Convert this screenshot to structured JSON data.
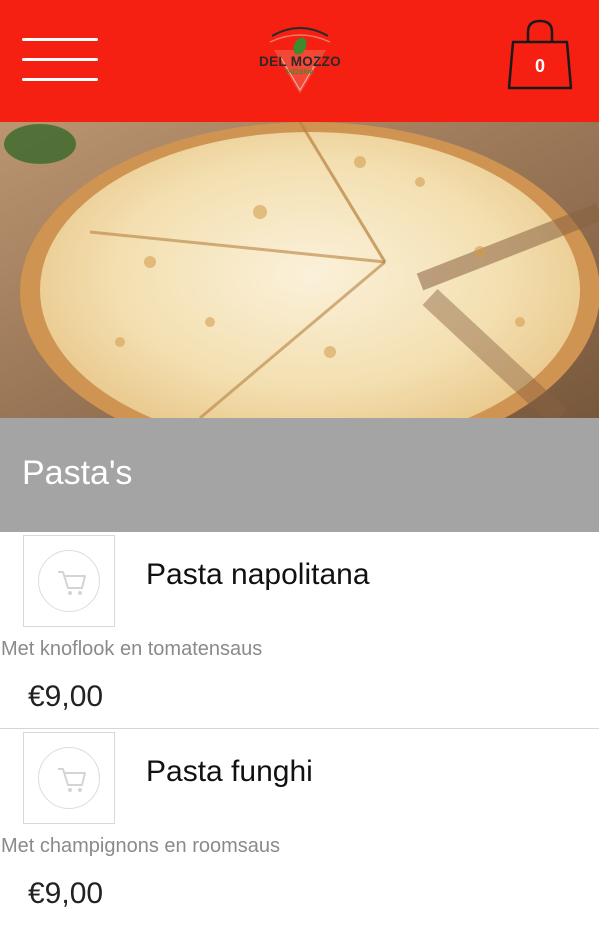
{
  "header": {
    "background_color": "#f51f12",
    "menu_icon": "hamburger-menu-icon",
    "logo": {
      "brand_text": "DEL MOZZO",
      "tagline": "PIZZERIA"
    },
    "cart": {
      "icon": "shopping-bag-icon",
      "count": "0"
    }
  },
  "hero": {
    "description": "photo of a sliced cheese pizza on a wooden board"
  },
  "section": {
    "title": "Pasta's",
    "background_color": "#a4a4a4"
  },
  "products": [
    {
      "name": "Pasta napolitana",
      "description": "Met knoflook en tomatensaus",
      "price": "€9,00",
      "icon": "add-to-cart-icon"
    },
    {
      "name": "Pasta funghi",
      "description": "Met champignons en roomsaus",
      "price": "€9,00",
      "icon": "add-to-cart-icon"
    }
  ]
}
